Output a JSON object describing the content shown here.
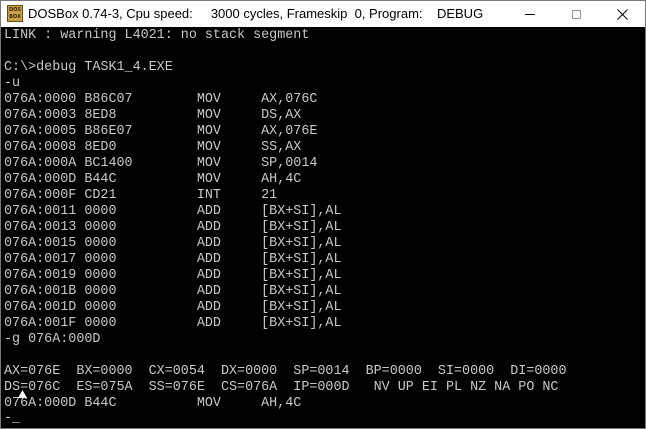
{
  "window": {
    "title": "DOSBox 0.74-3, Cpu speed:     3000 cycles, Frameskip  0, Program:    DEBUG",
    "icon_top": "DOS",
    "icon_bottom": "BOX"
  },
  "console": {
    "lines": [
      "LINK : warning L4021: no stack segment",
      "",
      "C:\\>debug TASK1_4.EXE",
      "-u",
      "076A:0000 B86C07        MOV     AX,076C",
      "076A:0003 8ED8          MOV     DS,AX",
      "076A:0005 B86E07        MOV     AX,076E",
      "076A:0008 8ED0          MOV     SS,AX",
      "076A:000A BC1400        MOV     SP,0014",
      "076A:000D B44C          MOV     AH,4C",
      "076A:000F CD21          INT     21",
      "076A:0011 0000          ADD     [BX+SI],AL",
      "076A:0013 0000          ADD     [BX+SI],AL",
      "076A:0015 0000          ADD     [BX+SI],AL",
      "076A:0017 0000          ADD     [BX+SI],AL",
      "076A:0019 0000          ADD     [BX+SI],AL",
      "076A:001B 0000          ADD     [BX+SI],AL",
      "076A:001D 0000          ADD     [BX+SI],AL",
      "076A:001F 0000          ADD     [BX+SI],AL",
      "-g 076A:000D",
      "",
      "AX=076E  BX=0000  CX=0054  DX=0000  SP=0014  BP=0000  SI=0000  DI=0000",
      "DS=076C  ES=075A  SS=076E  CS=076A  IP=000D   NV UP EI PL NZ NA PO NC",
      "076A:000D B44C          MOV     AH,4C"
    ],
    "prompt": "-_"
  },
  "colors": {
    "screen_background": "#000000",
    "screen_text": "#c8c8c8",
    "titlebar_background": "#ffffff"
  },
  "icons": {
    "app": "dosbox-icon",
    "minimize": "minimize-icon",
    "maximize": "maximize-icon",
    "close": "close-icon",
    "pointer": "mouse-pointer-icon"
  }
}
